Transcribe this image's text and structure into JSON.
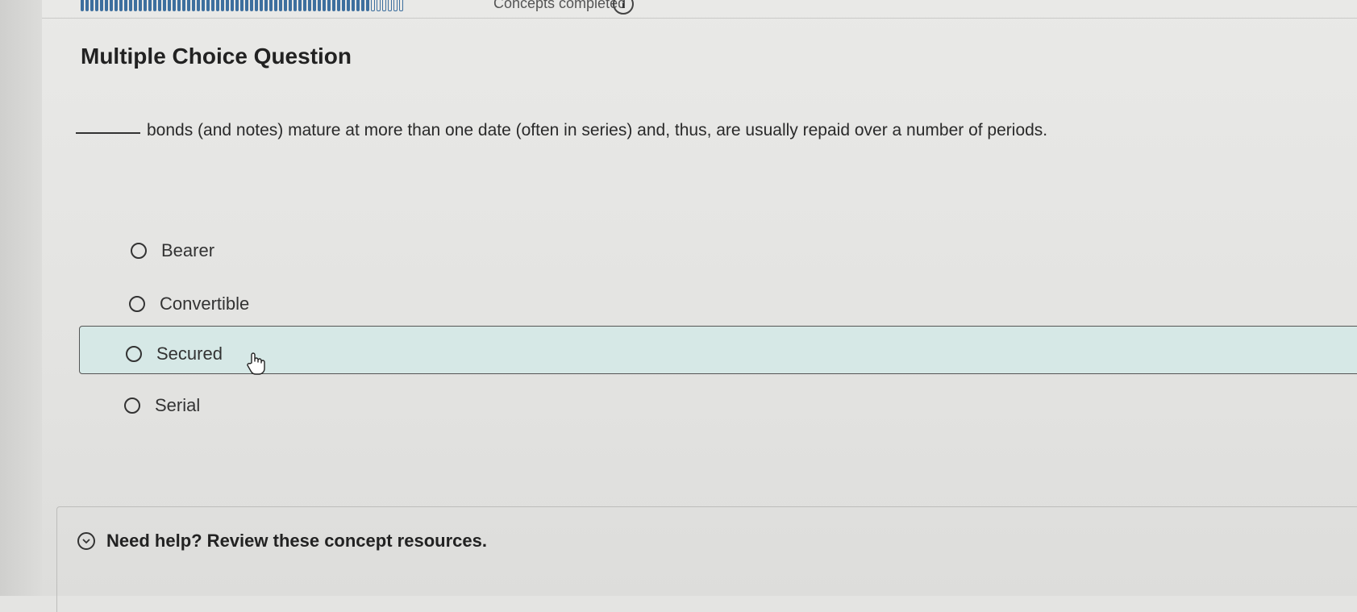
{
  "header": {
    "progress_label": "Concepts completed",
    "info_icon_glyph": "i",
    "progress_segments_filled": 60,
    "progress_segments_empty": 6
  },
  "question": {
    "type_label": "Multiple Choice Question",
    "text": "bonds (and notes) mature at more than one date (often in series) and, thus, are usually repaid over a number of periods."
  },
  "options": [
    {
      "label": "Bearer"
    },
    {
      "label": "Convertible"
    },
    {
      "label": "Secured"
    },
    {
      "label": "Serial"
    }
  ],
  "help": {
    "label": "Need help? Review these concept resources."
  },
  "colors": {
    "highlight": "#d6e8e6",
    "progress": "#3d6f9e"
  },
  "icons": {
    "info": "info-icon",
    "radio": "radio-icon",
    "expand": "chevron-down-icon",
    "cursor": "hand-cursor-icon"
  }
}
